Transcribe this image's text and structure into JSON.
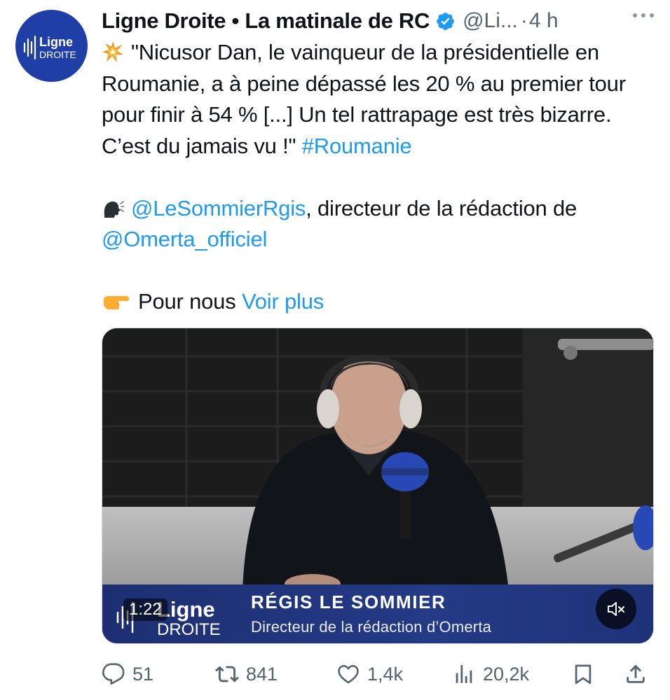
{
  "author": {
    "name": "Ligne Droite • La matinale de RC",
    "handle": "@Li...",
    "separator": "·",
    "time": "4 h",
    "avatar_text_top": "Ligne",
    "avatar_text_bottom": "DROITE"
  },
  "tweet": {
    "quote": "\"Nicusor Dan, le vainqueur de la présidentielle en Roumanie, a à peine dépassé les 20 % au premier tour pour finir à 54 % [...] Un tel rattrapage est très bizarre. C’est du jamais vu !\"",
    "hashtag": "#Roumanie",
    "speaker_mention": "@LeSommierRgis",
    "speaker_text": ", directeur de la rédaction de",
    "org_mention": "@Omerta_officiel",
    "more_prefix": "Pour nous",
    "more_link": "Voir plus"
  },
  "video": {
    "duration": "1:22",
    "lower_third_name": "RÉGIS LE SOMMIER",
    "lower_third_title": "Directeur de la rédaction d’Omerta",
    "logo_top": "Ligne",
    "logo_bottom": "DROITE"
  },
  "actions": {
    "replies": "51",
    "reposts": "841",
    "likes": "1,4k",
    "views": "20,2k"
  },
  "colors": {
    "link": "#1d9bf0",
    "secondary_text": "#536471",
    "brand_blue": "#1f3fa6"
  },
  "icons": [
    "collision-emoji",
    "speaking-head-emoji",
    "pointing-right-emoji",
    "verified-badge-icon",
    "more-icon",
    "mute-icon",
    "reply-icon",
    "repost-icon",
    "like-icon",
    "views-icon",
    "bookmark-icon",
    "share-icon"
  ]
}
